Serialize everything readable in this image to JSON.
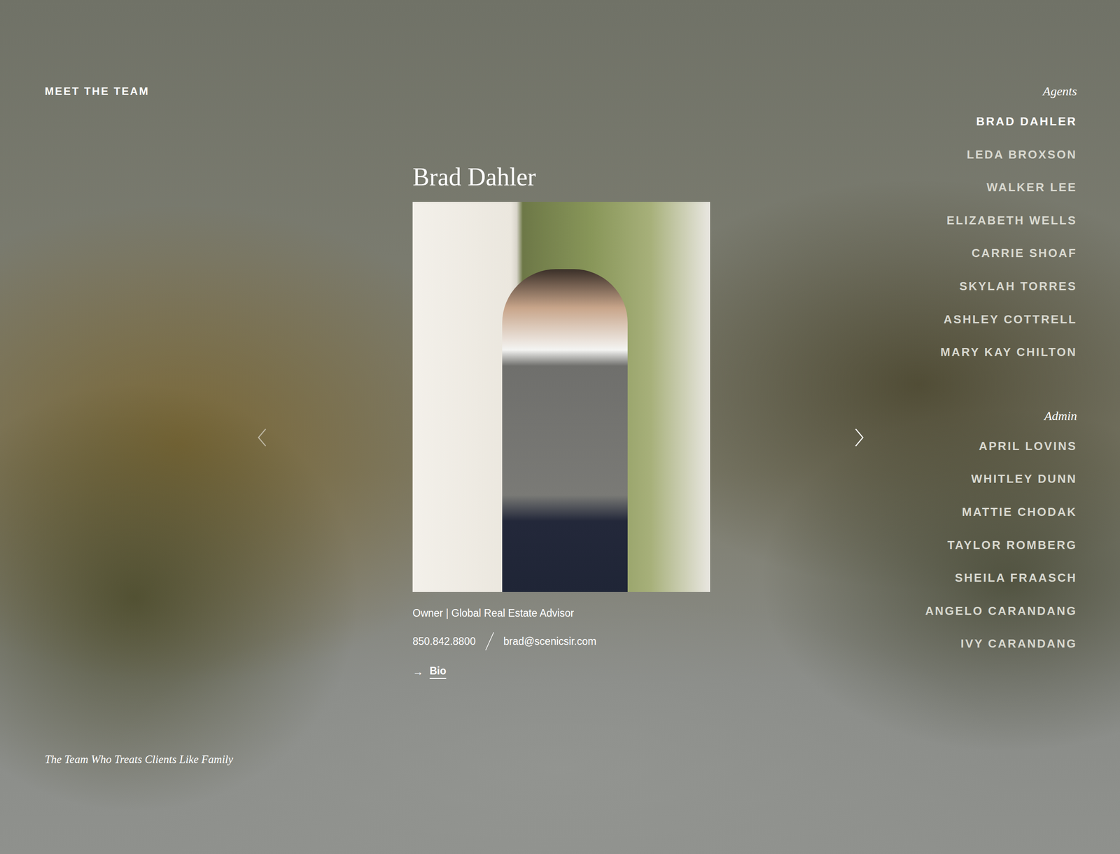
{
  "header": {
    "title": "MEET THE TEAM"
  },
  "tagline": "The Team Who Treats Clients Like Family",
  "carousel": {
    "prev_disabled": true,
    "next_disabled": false
  },
  "profile": {
    "name": "Brad Dahler",
    "role": "Owner | Global Real Estate Advisor",
    "phone": "850.842.8800",
    "email": "brad@scenicsir.com",
    "link_icon": "→",
    "link_label": "Bio"
  },
  "groups": [
    {
      "heading": "Agents",
      "members": [
        {
          "name": "BRAD DAHLER",
          "selected": true
        },
        {
          "name": "LEDA BROXSON",
          "selected": false
        },
        {
          "name": "WALKER LEE",
          "selected": false
        },
        {
          "name": "ELIZABETH WELLS",
          "selected": false
        },
        {
          "name": "CARRIE SHOAF",
          "selected": false
        },
        {
          "name": "SKYLAH TORRES",
          "selected": false
        },
        {
          "name": "ASHLEY COTTRELL",
          "selected": false
        },
        {
          "name": "MARY KAY CHILTON",
          "selected": false
        }
      ]
    },
    {
      "heading": "Admin",
      "members": [
        {
          "name": "APRIL LOVINS",
          "selected": false
        },
        {
          "name": "WHITLEY DUNN",
          "selected": false
        },
        {
          "name": "MATTIE CHODAK",
          "selected": false
        },
        {
          "name": "TAYLOR ROMBERG",
          "selected": false
        },
        {
          "name": "SHEILA FRAASCH",
          "selected": false
        },
        {
          "name": "ANGELO CARANDANG",
          "selected": false
        },
        {
          "name": "IVY CARANDANG",
          "selected": false
        }
      ]
    }
  ]
}
